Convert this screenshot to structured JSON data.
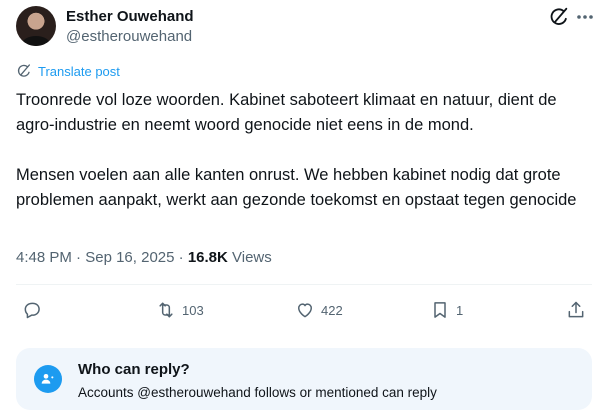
{
  "author": {
    "name": "Esther Ouwehand",
    "handle": "@estherouwehand"
  },
  "icons": {
    "grok": "grok-icon",
    "more": "more-icon",
    "reply": "reply-icon",
    "retweet": "retweet-icon",
    "like": "heart-icon",
    "bookmark": "bookmark-icon",
    "share": "share-icon",
    "who_can_reply": "mention-person-icon"
  },
  "translate_label": "Translate post",
  "post_text": "Troonrede vol loze woorden. Kabinet saboteert klimaat en natuur, dient de agro-industrie en neemt woord genocide niet eens in de mond.\n\nMensen voelen aan alle kanten onrust. We hebben kabinet nodig dat grote problemen aanpakt, werkt aan gezonde toekomst en opstaat tegen genocide",
  "meta": {
    "time": "4:48 PM",
    "sep": " · ",
    "date": "Sep 16, 2025",
    "views_count": "16.8K",
    "views_label": "Views"
  },
  "actions": {
    "retweets": "103",
    "likes": "422",
    "bookmarks": "1"
  },
  "reply_info": {
    "title": "Who can reply?",
    "subtitle": "Accounts @estherouwehand follows or mentioned can reply"
  },
  "colors": {
    "accent": "#1d9bf0",
    "muted": "#536471",
    "text": "#0f1419",
    "reply_box_bg": "#f0f6fc"
  }
}
